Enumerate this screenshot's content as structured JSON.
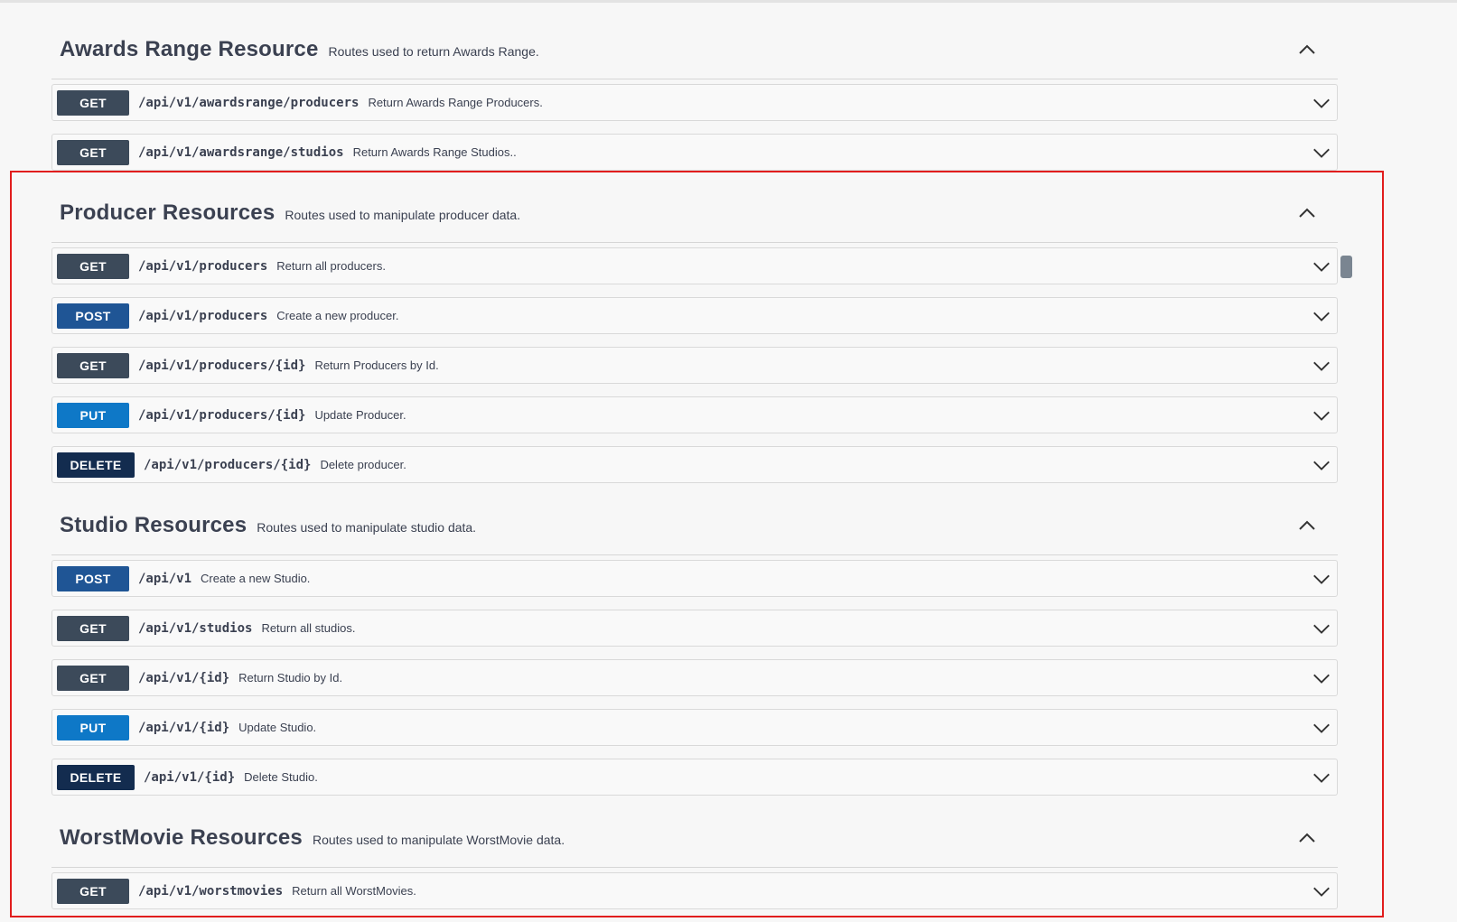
{
  "sections": [
    {
      "name": "Awards Range Resource",
      "description": "Routes used to return Awards Range.",
      "operations": [
        {
          "method": "GET",
          "path": "/api/v1/awardsrange/producers",
          "summary": "Return Awards Range Producers."
        },
        {
          "method": "GET",
          "path": "/api/v1/awardsrange/studios",
          "summary": "Return Awards Range Studios.."
        }
      ]
    },
    {
      "name": "Producer Resources",
      "description": "Routes used to manipulate producer data.",
      "operations": [
        {
          "method": "GET",
          "path": "/api/v1/producers",
          "summary": "Return all producers."
        },
        {
          "method": "POST",
          "path": "/api/v1/producers",
          "summary": "Create a new producer."
        },
        {
          "method": "GET",
          "path": "/api/v1/producers/{id}",
          "summary": "Return Producers by Id."
        },
        {
          "method": "PUT",
          "path": "/api/v1/producers/{id}",
          "summary": "Update Producer."
        },
        {
          "method": "DELETE",
          "path": "/api/v1/producers/{id}",
          "summary": "Delete producer."
        }
      ]
    },
    {
      "name": "Studio Resources",
      "description": "Routes used to manipulate studio data.",
      "operations": [
        {
          "method": "POST",
          "path": "/api/v1",
          "summary": "Create a new Studio."
        },
        {
          "method": "GET",
          "path": "/api/v1/studios",
          "summary": "Return all studios."
        },
        {
          "method": "GET",
          "path": "/api/v1/{id}",
          "summary": "Return Studio by Id."
        },
        {
          "method": "PUT",
          "path": "/api/v1/{id}",
          "summary": "Update Studio."
        },
        {
          "method": "DELETE",
          "path": "/api/v1/{id}",
          "summary": "Delete Studio."
        }
      ]
    },
    {
      "name": "WorstMovie Resources",
      "description": "Routes used to manipulate WorstMovie data.",
      "operations": [
        {
          "method": "GET",
          "path": "/api/v1/worstmovies",
          "summary": "Return all WorstMovies."
        }
      ]
    }
  ],
  "colors": {
    "get": "#3c4a5a",
    "post": "#1f5595",
    "put": "#0e78c7",
    "delete": "#132c4f",
    "highlight_border": "#e11d1d"
  },
  "icons": {
    "section_toggle": "chevron-up-icon",
    "operation_toggle": "chevron-down-icon"
  }
}
